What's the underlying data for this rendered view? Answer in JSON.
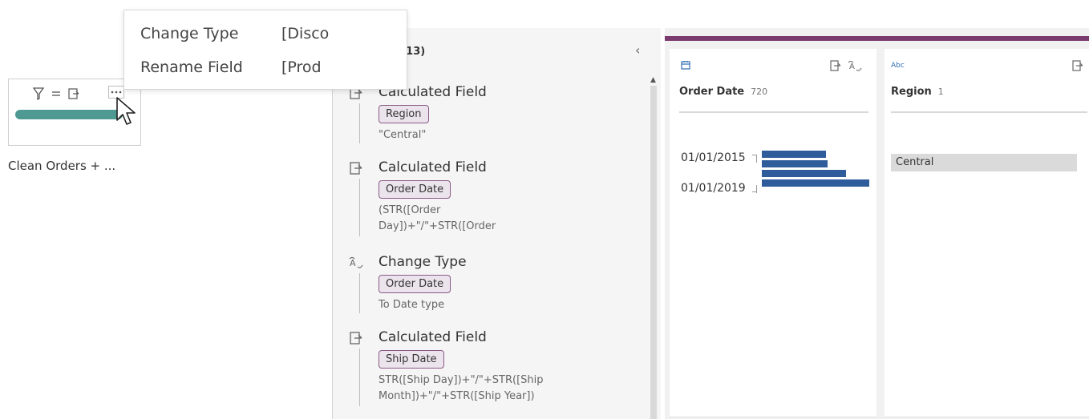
{
  "flow_step": {
    "label": "Clean Orders + ..."
  },
  "context_menu": {
    "items": [
      {
        "label": "Change Type",
        "value": "[Disco"
      },
      {
        "label": "Rename Field",
        "value": "[Prod"
      }
    ]
  },
  "changes_panel": {
    "title": "Changes (13)",
    "collapse_glyph": "‹",
    "entries": [
      {
        "icon": "calculated-field-icon",
        "name": "Calculated Field",
        "field": "Region",
        "desc": [
          "\"Central\""
        ]
      },
      {
        "icon": "calculated-field-icon",
        "name": "Calculated Field",
        "field": "Order Date",
        "desc": [
          "(STR([Order",
          "Day])+\"/\"+STR([Order"
        ]
      },
      {
        "icon": "change-type-icon",
        "name": "Change Type",
        "field": "Order Date",
        "desc": [
          "To Date type"
        ]
      },
      {
        "icon": "calculated-field-icon",
        "name": "Calculated Field",
        "field": "Ship Date",
        "desc": [
          "STR([Ship Day])+\"/\"+STR([Ship",
          "Month])+\"/\"+STR([Ship Year])"
        ]
      }
    ]
  },
  "grid": {
    "accent_color": "#7a3b6e",
    "columns": [
      {
        "name": "Order Date",
        "count": "720",
        "type_icon": "calendar-icon",
        "axis_labels": [
          "01/01/2015",
          "01/01/2019"
        ],
        "histogram_relative_values": [
          0.6,
          0.61,
          0.78,
          1.0
        ]
      },
      {
        "name": "Region",
        "count": "1",
        "type_icon": "abc-type-icon",
        "type_label": "Abc",
        "values": [
          "Central"
        ]
      }
    ]
  },
  "colors": {
    "step_bar": "#4e9a93",
    "histogram_bar": "#2f5d9b",
    "pill_border": "#8a5a86",
    "pill_bg": "#ece4ec"
  }
}
